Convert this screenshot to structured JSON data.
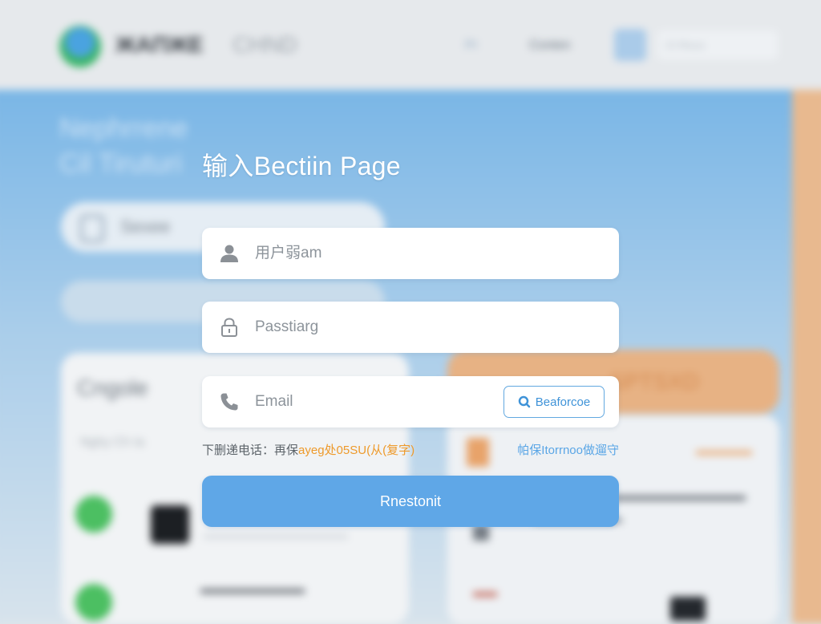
{
  "background": {
    "brand_name": "ЖAΠЖЕ",
    "brand_suffix": "CHND",
    "nav_link": "Pr",
    "nav_link_2": "Conten",
    "search_placeholder": "Cl Rxco",
    "hero_title_line1": "Nephrrene",
    "hero_title_line2": "Cil Tiruturi",
    "pill_label": "Sexee",
    "card_left_title": "Cngole",
    "card_left_sub": "Nghy Ch Ia",
    "orange_card_label": "SPTSXD"
  },
  "login": {
    "title": "输入Bectiin  Page",
    "username": {
      "placeholder": "用户弱am",
      "value": ""
    },
    "password": {
      "placeholder": "Passtiarg",
      "value": ""
    },
    "email": {
      "placeholder": "Email",
      "value": ""
    },
    "code_button_label": "Beaforcoe",
    "hint_left_prefix": "下删递电话：",
    "hint_left_mid": "再保",
    "hint_left_highlight": "ayeg处05SU(从(复字)",
    "hint_right": "帕保Itorrnoo做遛守",
    "submit_label": "Rnestonit"
  },
  "icons": {
    "username": "user-icon",
    "password": "lock-icon",
    "email": "phone-icon",
    "code_button": "search-icon"
  },
  "colors": {
    "accent": "#5fa7e7",
    "highlight": "#ee9a2b",
    "link": "#5aa6e6"
  }
}
